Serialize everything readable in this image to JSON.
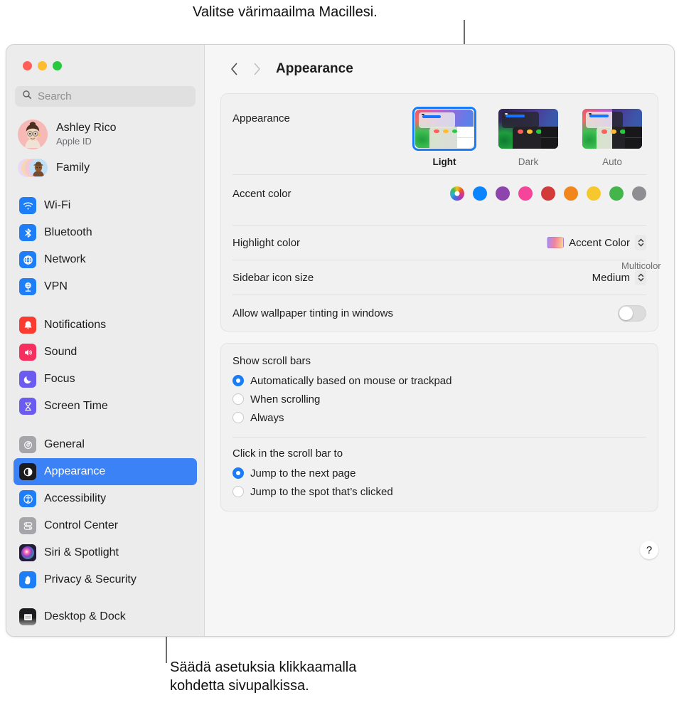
{
  "callouts": {
    "top": "Valitse värimaailma Macillesi.",
    "bottom": "Säädä asetuksia klikkaamalla\nkohdetta sivupalkissa."
  },
  "window": {
    "nav": {
      "back": "‹",
      "forward": "›"
    },
    "title": "Appearance"
  },
  "sidebar": {
    "search": {
      "placeholder": "Search",
      "icon": "search-icon"
    },
    "account": {
      "name": "Ashley Rico",
      "subtitle": "Apple ID",
      "avatar_icon": "memoji-avatar"
    },
    "family": {
      "label": "Family",
      "icon": "family-avatars"
    },
    "groups": [
      {
        "items": [
          {
            "label": "Wi-Fi",
            "icon": "wifi-icon",
            "color": "#1e7ef7",
            "selected": false
          },
          {
            "label": "Bluetooth",
            "icon": "bluetooth-icon",
            "color": "#1e7ef7",
            "selected": false
          },
          {
            "label": "Network",
            "icon": "network-globe-icon",
            "color": "#1e7ef7",
            "selected": false
          },
          {
            "label": "VPN",
            "icon": "vpn-icon",
            "color": "#1e7ef7",
            "selected": false
          }
        ]
      },
      {
        "items": [
          {
            "label": "Notifications",
            "icon": "bell-icon",
            "color": "#fb3b30",
            "selected": false
          },
          {
            "label": "Sound",
            "icon": "speaker-icon",
            "color": "#f62f5e",
            "selected": false
          },
          {
            "label": "Focus",
            "icon": "moon-icon",
            "color": "#6b5bf0",
            "selected": false
          },
          {
            "label": "Screen Time",
            "icon": "hourglass-icon",
            "color": "#6b5bf0",
            "selected": false
          }
        ]
      },
      {
        "items": [
          {
            "label": "General",
            "icon": "gear-icon",
            "color": "#8e8e93",
            "selected": false
          },
          {
            "label": "Appearance",
            "icon": "appearance-contrast-icon",
            "color": "#1c1c1e",
            "selected": true
          },
          {
            "label": "Accessibility",
            "icon": "accessibility-icon",
            "color": "#1e7ef7",
            "selected": false
          },
          {
            "label": "Control Center",
            "icon": "control-center-icon",
            "color": "#8e8e93",
            "selected": false
          },
          {
            "label": "Siri & Spotlight",
            "icon": "siri-icon",
            "color": "#2a2040",
            "selected": false
          },
          {
            "label": "Privacy & Security",
            "icon": "hand-icon",
            "color": "#1e7ef7",
            "selected": false
          }
        ]
      },
      {
        "items": [
          {
            "label": "Desktop & Dock",
            "icon": "desktop-dock-icon",
            "color": "#1c1c1e",
            "selected": false
          }
        ]
      }
    ]
  },
  "main": {
    "appearance": {
      "label": "Appearance",
      "options": [
        {
          "name": "Light",
          "selected": true
        },
        {
          "name": "Dark",
          "selected": false
        },
        {
          "name": "Auto",
          "selected": false
        }
      ]
    },
    "accent": {
      "label": "Accent color",
      "caption": "Multicolor",
      "swatches": [
        {
          "name": "Multicolor",
          "color": "multicolor",
          "selected": true
        },
        {
          "name": "Blue",
          "color": "#0a84ff",
          "selected": false
        },
        {
          "name": "Purple",
          "color": "#8e44ad",
          "selected": false
        },
        {
          "name": "Pink",
          "color": "#f5459a",
          "selected": false
        },
        {
          "name": "Red",
          "color": "#d33b3b",
          "selected": false
        },
        {
          "name": "Orange",
          "color": "#f0861c",
          "selected": false
        },
        {
          "name": "Yellow",
          "color": "#f7c82e",
          "selected": false
        },
        {
          "name": "Green",
          "color": "#44b54a",
          "selected": false
        },
        {
          "name": "Graphite",
          "color": "#8e8e93",
          "selected": false
        }
      ]
    },
    "highlight": {
      "label": "Highlight color",
      "value": "Accent Color"
    },
    "sidebar_icon_size": {
      "label": "Sidebar icon size",
      "value": "Medium"
    },
    "wallpaper_tinting": {
      "label": "Allow wallpaper tinting in windows",
      "enabled": false
    },
    "scrollbars": {
      "heading": "Show scroll bars",
      "options": [
        {
          "label": "Automatically based on mouse or trackpad",
          "selected": true
        },
        {
          "label": "When scrolling",
          "selected": false
        },
        {
          "label": "Always",
          "selected": false
        }
      ]
    },
    "scrollclick": {
      "heading": "Click in the scroll bar to",
      "options": [
        {
          "label": "Jump to the next page",
          "selected": true
        },
        {
          "label": "Jump to the spot that’s clicked",
          "selected": false
        }
      ]
    },
    "help": {
      "label": "?"
    }
  }
}
